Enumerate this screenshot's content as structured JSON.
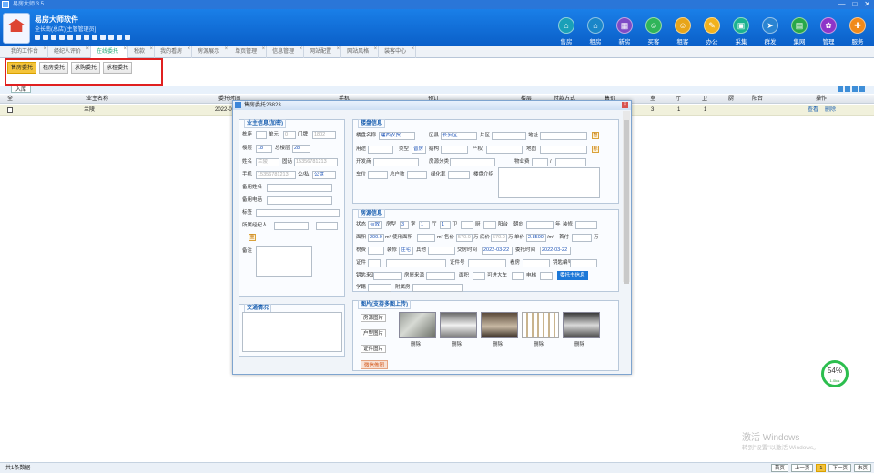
{
  "window": {
    "title": "易房大师 3.5",
    "min": "—",
    "max": "□",
    "close": "✕"
  },
  "header": {
    "brand": "易房大师软件",
    "sub": "全长南(总店)[主管管理员]"
  },
  "nav": [
    {
      "label": "售房",
      "icon": "house-icon",
      "color": "#1aa0b8",
      "glyph": "⌂"
    },
    {
      "label": "租房",
      "icon": "rent-icon",
      "color": "#1a86c8",
      "glyph": "⌂"
    },
    {
      "label": "新房",
      "icon": "building-icon",
      "color": "#7e4bc6",
      "glyph": "▦"
    },
    {
      "label": "买客",
      "icon": "buyer-icon",
      "color": "#2fb55a",
      "glyph": "☺"
    },
    {
      "label": "租客",
      "icon": "tenant-icon",
      "color": "#e7a51a",
      "glyph": "☺"
    },
    {
      "label": "办公",
      "icon": "office-icon",
      "color": "#f2b21e",
      "glyph": "✎"
    },
    {
      "label": "采集",
      "icon": "collect-icon",
      "color": "#1ab290",
      "glyph": "▣"
    },
    {
      "label": "群发",
      "icon": "send-icon",
      "color": "#2a84d2",
      "glyph": "➤"
    },
    {
      "label": "集网",
      "icon": "network-icon",
      "color": "#28a848",
      "glyph": "▤"
    },
    {
      "label": "管理",
      "icon": "gear-icon",
      "color": "#8e35c8",
      "glyph": "✿"
    },
    {
      "label": "服务",
      "icon": "service-icon",
      "color": "#f08a1a",
      "glyph": "✚"
    }
  ],
  "tabs": [
    {
      "label": "我的工作台",
      "active": false
    },
    {
      "label": "经纪人评价",
      "active": false
    },
    {
      "label": "在线委托",
      "active": true
    },
    {
      "label": "税款",
      "active": false
    },
    {
      "label": "我的看房",
      "active": false
    },
    {
      "label": "房源展示",
      "active": false
    },
    {
      "label": "单页管理",
      "active": false
    },
    {
      "label": "信息管理",
      "active": false
    },
    {
      "label": "网站配置",
      "active": false
    },
    {
      "label": "网站风格",
      "active": false
    },
    {
      "label": "装客中心",
      "active": false
    }
  ],
  "subtabs": [
    {
      "label": "售房委托",
      "active": true
    },
    {
      "label": "租房委托",
      "active": false
    },
    {
      "label": "求购委托",
      "active": false
    },
    {
      "label": "求租委托",
      "active": false
    }
  ],
  "add_label": "入库",
  "grid": {
    "headers": [
      "全",
      "业主名称",
      "委托时间",
      "手机",
      "预订",
      "楼层",
      "付款方式",
      "售价",
      "室",
      "厅",
      "卫",
      "厨",
      "阳台",
      "操作"
    ],
    "row": {
      "name": "兰陵",
      "time": "2022-0",
      "rooms": "3",
      "halls": "1",
      "baths": "1",
      "view": "查看",
      "delete": "删除"
    }
  },
  "dialog": {
    "title": "售房委托23823",
    "owner": {
      "title": "业主信息(加密)",
      "building": "栋座",
      "unit": "单元",
      "unit_val": "0",
      "door": "门牌",
      "door_val": "1802",
      "floor": "楼层",
      "floor_val": "18",
      "total_floor": "总楼层",
      "total_floor_val": "28",
      "name": "姓名",
      "name_val": "兰陵",
      "phone": "固话",
      "phone_val": "15356781213",
      "mobile": "手机",
      "mobile_val": "15356781213",
      "pubpriv": "公/私",
      "pubpriv_val": "公盘",
      "alt_name": "备用姓名",
      "alt_phone": "备用电话",
      "tag": "标签",
      "agent": "所属经纪人",
      "agent_btn": "重",
      "note": "备注"
    },
    "traffic": {
      "title": "交通情况"
    },
    "estate": {
      "title": "楼盘信息",
      "name": "楼盘名称",
      "name_val": "建西农贸",
      "district": "区县",
      "district_val": "长安区",
      "area": "片区",
      "address": "地址",
      "addr_btn": "智",
      "use": "用途",
      "type": "类型",
      "type_val": "普房",
      "structure": "结构",
      "property": "产权",
      "map": "地图",
      "map_btn": "标",
      "developer": "开发商",
      "class": "房源分类",
      "mgmt": "物业费",
      "slash": "/",
      "parking": "车位",
      "households": "总户数",
      "green": "绿化率",
      "intro": "楼盘介绍"
    },
    "house": {
      "title": "房源信息",
      "status": "状态",
      "status_val": "有效",
      "layout": "房型",
      "rooms": "3",
      "room": "室",
      "halls": "1",
      "hall": "厅",
      "baths": "1",
      "bath": "卫",
      "kitchen": "厨",
      "balcony": "阳台",
      "direction": "朝向",
      "age": "年",
      "decor": "装修",
      "area": "面积",
      "area_val": "200.0",
      "m2": "m²",
      "usable": "使用面积",
      "m2b": "m²",
      "sale": "售价",
      "sale_val": "570.0",
      "wan": "万",
      "base": "底价",
      "base_val": "570.0",
      "wan2": "万",
      "unit": "单价",
      "unit_val": "2.8500",
      "perm2": "/m²",
      "down": "首付",
      "wan3": "万",
      "tax": "税费",
      "style": "装修",
      "style_val": "住宅",
      "other": "其他",
      "date": "交房时间",
      "date_val": "2022-03-22",
      "entrust": "委托时间",
      "entrust_val": "2022-03-22",
      "cert": "证件",
      "cert_no": "证件号",
      "view": "看房",
      "key_no": "钥匙编号",
      "key_src": "钥匙来源",
      "src": "房屋来源",
      "own": "面积",
      "elevator": "可进大车",
      "lift": "电梯",
      "deed_btn": "委托书信息",
      "school": "学籍",
      "community": "附属房"
    },
    "photos": {
      "title": "图片(支持多图上传)",
      "btn_house": "房源图片",
      "btn_layout": "户型图片",
      "btn_cert": "证件图片",
      "btn_wx": "微信佈图",
      "items": [
        "删除",
        "删除",
        "删除",
        "删除",
        "删除"
      ]
    }
  },
  "gauge": {
    "value": "54%",
    "sub": "1.0k/s"
  },
  "watermark": {
    "line1": "激活 Windows",
    "line2": "转到\"设置\"以激活 Windows。"
  },
  "footer": {
    "count": "共1条数据",
    "first": "首页",
    "prev": "上一页",
    "page": "1",
    "next": "下一页",
    "last": "末页"
  }
}
